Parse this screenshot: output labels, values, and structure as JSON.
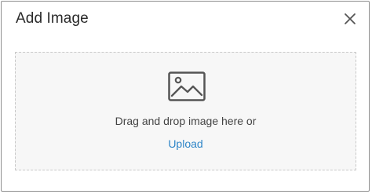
{
  "dialog": {
    "title": "Add Image",
    "close_icon": "close-icon"
  },
  "dropzone": {
    "icon": "image-icon",
    "instruction": "Drag and drop image here or",
    "upload_label": "Upload"
  },
  "colors": {
    "title_text": "#2a2a2a",
    "body_text": "#444444",
    "link": "#2f86c8",
    "dropzone_bg": "#f7f7f7",
    "dropzone_border": "#c8c8c8",
    "icon": "#555555"
  }
}
